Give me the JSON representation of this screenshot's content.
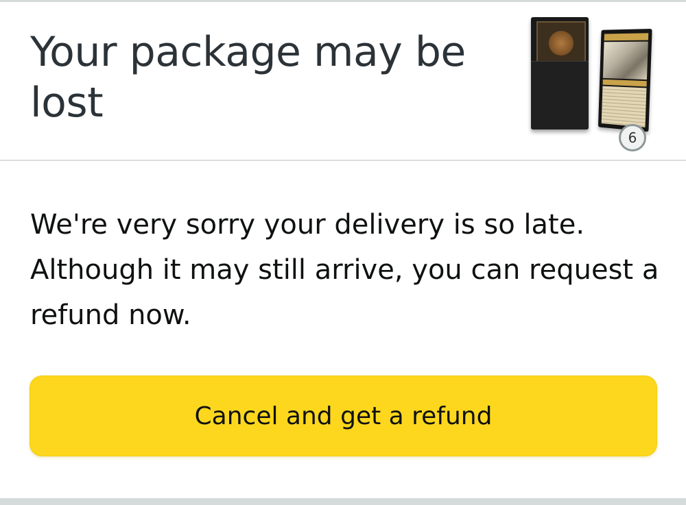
{
  "header": {
    "title": "Your package may be lost",
    "item_count": "6",
    "thumbnail_icons": [
      "card-sleeve-image",
      "trading-card-image"
    ]
  },
  "message": {
    "text": "We're very sorry your delivery is so late. Although it may still arrive, you can request a refund now."
  },
  "actions": {
    "refund_button_label": "Cancel and get a refund"
  },
  "colors": {
    "button_background": "#fcd71d",
    "text": "#0f1111",
    "title_text": "#2c3338",
    "divider": "#dddddd",
    "page_background": "#ffffff"
  }
}
